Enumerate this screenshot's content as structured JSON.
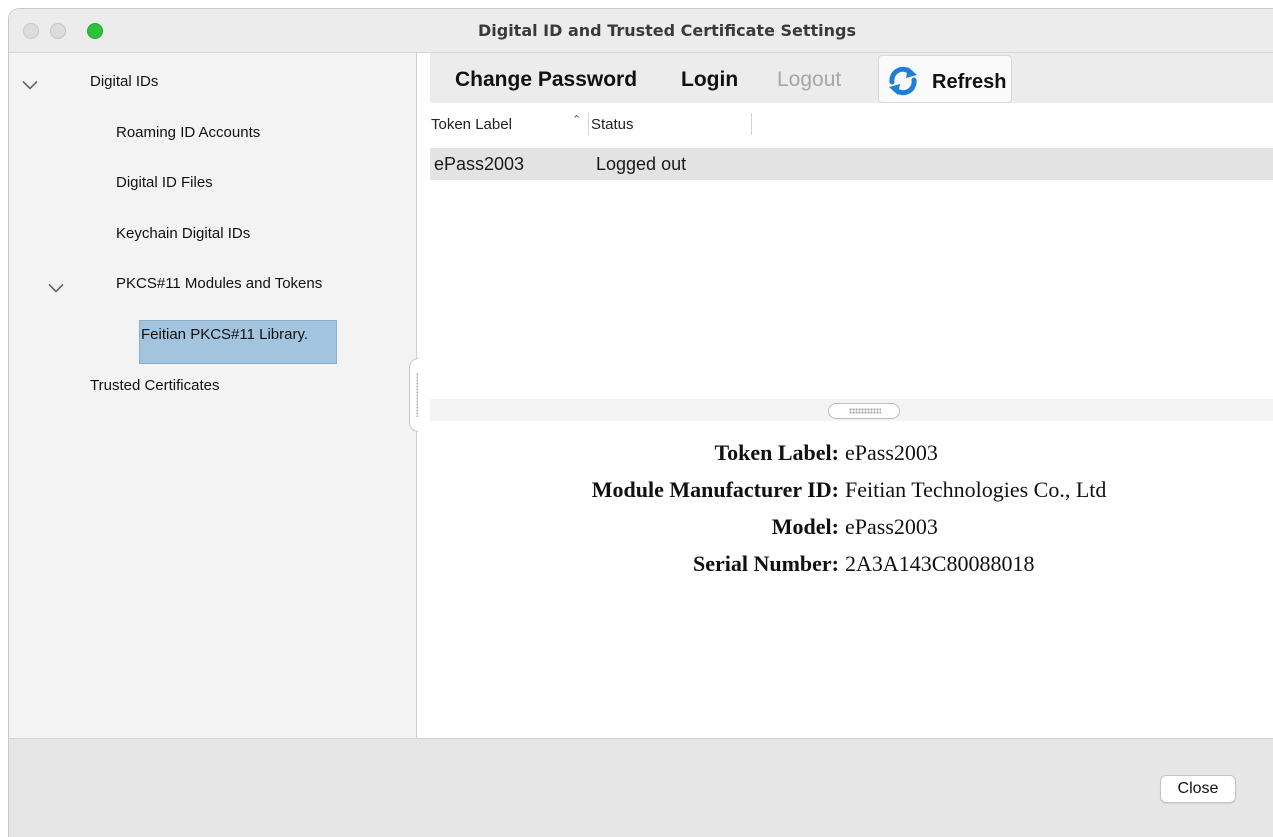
{
  "window": {
    "title": "Digital ID and Trusted Certificate Settings"
  },
  "sidebar": {
    "items": [
      {
        "label": "Digital IDs",
        "expanded": true
      },
      {
        "label": "Roaming ID Accounts"
      },
      {
        "label": "Digital ID Files"
      },
      {
        "label": "Keychain Digital IDs"
      },
      {
        "label": "PKCS#11 Modules and Tokens",
        "expanded": true
      },
      {
        "label": "Feitian PKCS#11 Library.",
        "selected": true
      },
      {
        "label": "Trusted Certificates"
      }
    ]
  },
  "toolbar": {
    "change_password": "Change Password",
    "login": "Login",
    "logout": "Logout",
    "refresh": "Refresh"
  },
  "table": {
    "columns": [
      "Token Label",
      "Status"
    ],
    "sort_column": "Token Label",
    "rows": [
      {
        "token_label": "ePass2003",
        "status": "Logged out"
      }
    ]
  },
  "details": [
    {
      "key": "Token Label:",
      "value": "ePass2003"
    },
    {
      "key": "Module Manufacturer ID:",
      "value": "Feitian Technologies Co., Ltd"
    },
    {
      "key": "Model:",
      "value": "ePass2003"
    },
    {
      "key": "Serial Number:",
      "value": "2A3A143C80088018"
    }
  ],
  "footer": {
    "close": "Close"
  },
  "colors": {
    "selection": "#a3c4de",
    "traffic_green": "#2cc23a",
    "refresh_blue": "#1f7fd6"
  },
  "icons": {
    "refresh": "refresh-icon",
    "expand": "chevron-down-icon"
  }
}
